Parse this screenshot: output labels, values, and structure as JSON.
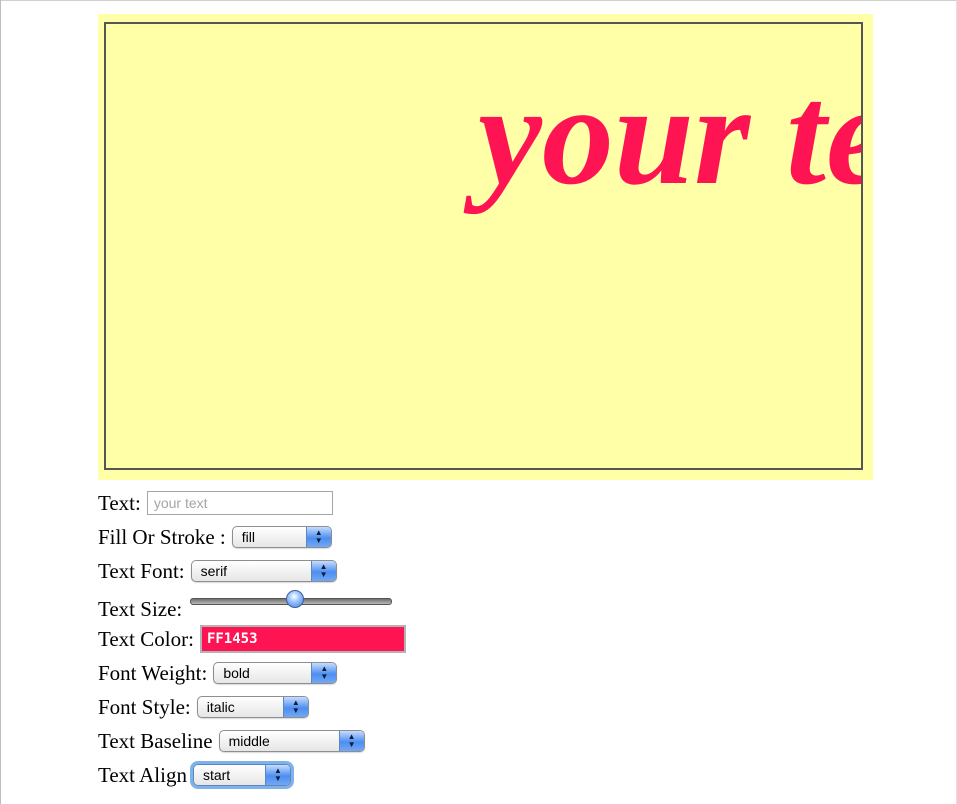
{
  "canvas": {
    "background": "#FFFFA8",
    "display_text": "your text"
  },
  "controls": {
    "text": {
      "label": "Text:",
      "placeholder": "your text",
      "value": ""
    },
    "fill_or_stroke": {
      "label": "Fill Or Stroke :",
      "selected": "fill"
    },
    "text_font": {
      "label": "Text Font:",
      "selected": "serif"
    },
    "text_size": {
      "label": "Text Size:",
      "level_percent": 52
    },
    "text_color": {
      "label": "Text Color:",
      "value": "FF1453",
      "color": "#FF1453"
    },
    "font_weight": {
      "label": "Font Weight:",
      "selected": "bold"
    },
    "font_style": {
      "label": "Font Style:",
      "selected": "italic"
    },
    "text_baseline": {
      "label": "Text Baseline",
      "selected": "middle"
    },
    "text_align": {
      "label": "Text Align",
      "selected": "start"
    }
  }
}
